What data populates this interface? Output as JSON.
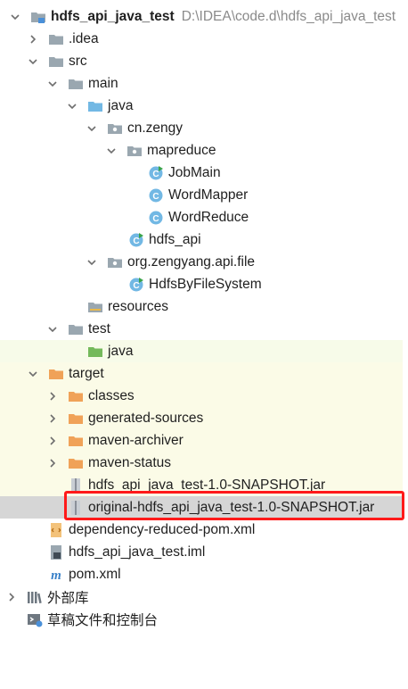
{
  "project": {
    "name": "hdfs_api_java_test",
    "path": "D:\\IDEA\\code.d\\hdfs_api_java_test"
  },
  "tree": {
    "idea": ".idea",
    "src": "src",
    "main": "main",
    "java_main": "java",
    "pkg_cn": "cn.zengy",
    "pkg_mapreduce": "mapreduce",
    "job_main": "JobMain",
    "word_mapper": "WordMapper",
    "word_reduce": "WordReduce",
    "hdfs_api": "hdfs_api",
    "pkg_org": "org.zengyang.api.file",
    "hdfs_by_fs": "HdfsByFileSystem",
    "resources": "resources",
    "test": "test",
    "java_test": "java",
    "target": "target",
    "classes": "classes",
    "generated_sources": "generated-sources",
    "maven_archiver": "maven-archiver",
    "maven_status": "maven-status",
    "jar": "hdfs_api_java_test-1.0-SNAPSHOT.jar",
    "original_jar": "original-hdfs_api_java_test-1.0-SNAPSHOT.jar",
    "dep_pom": "dependency-reduced-pom.xml",
    "iml": "hdfs_api_java_test.iml",
    "pom": "pom.xml",
    "external_libs": "外部库",
    "scratches": "草稿文件和控制台"
  },
  "colors": {
    "folder_gray": "#9aa7b0",
    "source_blue": "#72b8e4",
    "test_green": "#74b95b",
    "excluded_orange": "#f0a258",
    "selection_border": "#ff1a1a"
  }
}
